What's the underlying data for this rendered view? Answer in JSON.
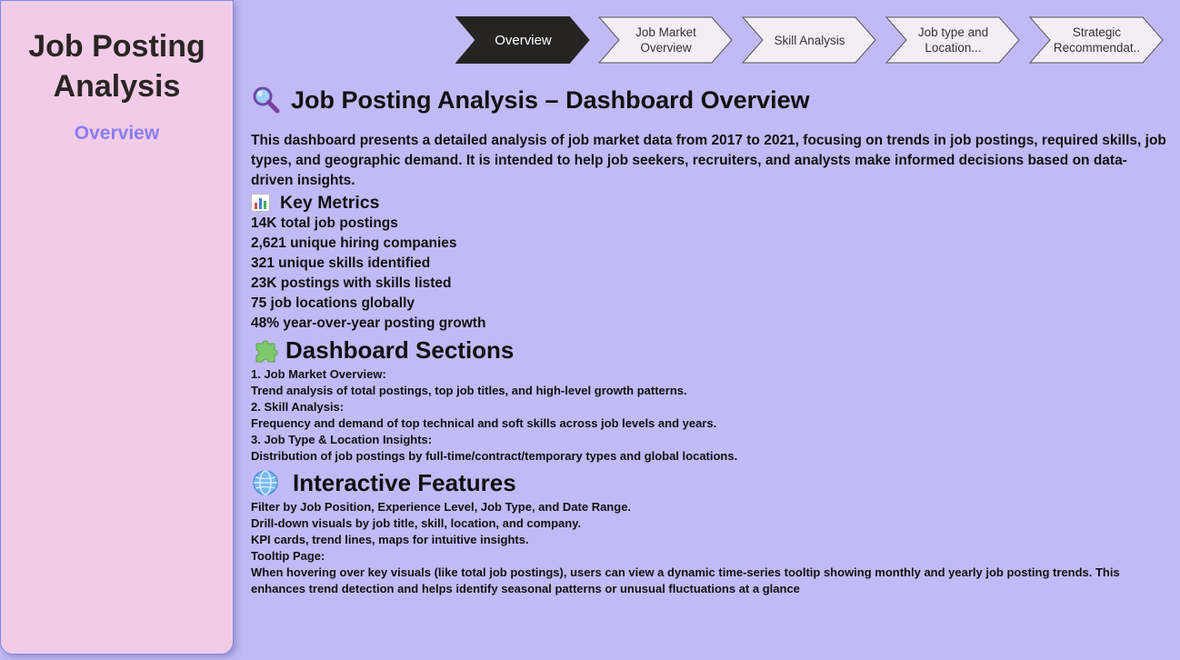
{
  "sidebar": {
    "title": "Job Posting Analysis",
    "subtitle": "Overview"
  },
  "nav": {
    "items": [
      {
        "label": "Overview",
        "active": true
      },
      {
        "label": "Job Market Overview",
        "active": false
      },
      {
        "label": "Skill Analysis",
        "active": false
      },
      {
        "label": "Job type and Location...",
        "active": false
      },
      {
        "label": "Strategic Recommendat..",
        "active": false
      }
    ]
  },
  "main": {
    "heading": "Job Posting Analysis – Dashboard Overview",
    "heading_icon": "magnifier-icon",
    "intro": "This dashboard presents a detailed analysis of job market data from 2017 to 2021, focusing on trends in job postings, required skills, job types, and geographic demand. It is intended to help job seekers, recruiters, and analysts make informed decisions based on data-driven insights.",
    "key_metrics": {
      "heading": "Key Metrics",
      "icon": "bar-chart-icon",
      "items": [
        "14K total job postings",
        "2,621 unique hiring companies",
        "321 unique skills identified",
        "23K postings with skills listed",
        "75 job locations globally",
        "48% year-over-year posting growth"
      ]
    },
    "sections": {
      "heading": "Dashboard Sections",
      "icon": "puzzle-icon",
      "lines": [
        "1. Job Market Overview:",
        "Trend analysis of total postings, top job titles, and high-level growth patterns.",
        "2. Skill Analysis:",
        "Frequency and demand of top technical and soft skills across job levels and years.",
        "3. Job Type & Location Insights:",
        "Distribution of job postings by full-time/contract/temporary types and global locations."
      ]
    },
    "features": {
      "heading": "Interactive Features",
      "icon": "globe-icon",
      "lines": [
        "Filter by Job Position, Experience Level, Job Type, and Date Range.",
        "Drill-down visuals by job title, skill, location, and company.",
        "KPI cards, trend lines, maps for intuitive insights.",
        "Tooltip Page:",
        "When hovering over key visuals (like total job postings), users can view a dynamic time-series tooltip showing monthly and yearly job posting trends. This enhances trend detection and helps identify seasonal patterns or unusual fluctuations at a glance"
      ]
    }
  },
  "colors": {
    "background": "#c1baf6",
    "sidebar": "#f2cbe8",
    "accent": "#8b7df0",
    "nav_active": "#252423",
    "nav_inactive": "#f3eef6"
  }
}
